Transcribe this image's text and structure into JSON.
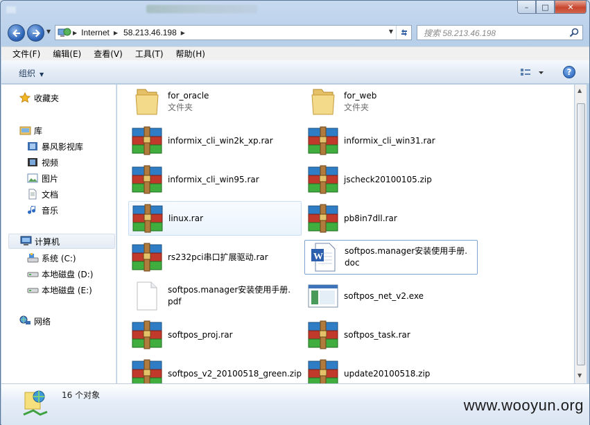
{
  "titlebar": {
    "minimize": "–",
    "maximize": "□",
    "close": "✕"
  },
  "address": {
    "crumbs": [
      "Internet",
      "58.213.46.198"
    ]
  },
  "search": {
    "placeholder": "搜索 58.213.46.198"
  },
  "menu": [
    "文件(F)",
    "编辑(E)",
    "查看(V)",
    "工具(T)",
    "帮助(H)"
  ],
  "toolbar": {
    "organize": "组织",
    "help": "?"
  },
  "nav": {
    "favorites": "收藏夹",
    "libraries": "库",
    "library_items": [
      "暴风影视库",
      "视频",
      "图片",
      "文档",
      "音乐"
    ],
    "computer": "计算机",
    "drives": [
      "系统 (C:)",
      "本地磁盘 (D:)",
      "本地磁盘 (E:)"
    ],
    "network": "网络"
  },
  "files": [
    {
      "name": "for_oracle",
      "type": "文件夹",
      "icon": "folder"
    },
    {
      "name": "for_web",
      "type": "文件夹",
      "icon": "folder"
    },
    {
      "name": "informix_cli_win2k_xp.rar",
      "icon": "archive"
    },
    {
      "name": "informix_cli_win31.rar",
      "icon": "archive"
    },
    {
      "name": "informix_cli_win95.rar",
      "icon": "archive"
    },
    {
      "name": "jscheck20100105.zip",
      "icon": "archive"
    },
    {
      "name": "linux.rar",
      "icon": "archive"
    },
    {
      "name": "pb8in7dll.rar",
      "icon": "archive"
    },
    {
      "name": "rs232pci串口扩展驱动.rar",
      "icon": "archive"
    },
    {
      "name": "softpos.manager安装使用手册.",
      "name2": "doc",
      "icon": "word"
    },
    {
      "name": "softpos.manager安装使用手册.",
      "name2": "pdf",
      "icon": "blank"
    },
    {
      "name": "softpos_net_v2.exe",
      "icon": "exe"
    },
    {
      "name": "softpos_proj.rar",
      "icon": "archive"
    },
    {
      "name": "softpos_task.rar",
      "icon": "archive"
    },
    {
      "name": "softpos_v2_20100518_green.zip",
      "icon": "archive"
    },
    {
      "name": "update20100518.zip",
      "icon": "archive"
    }
  ],
  "status": {
    "count_text": "16 个对象"
  },
  "watermark": "www.wooyun.org"
}
